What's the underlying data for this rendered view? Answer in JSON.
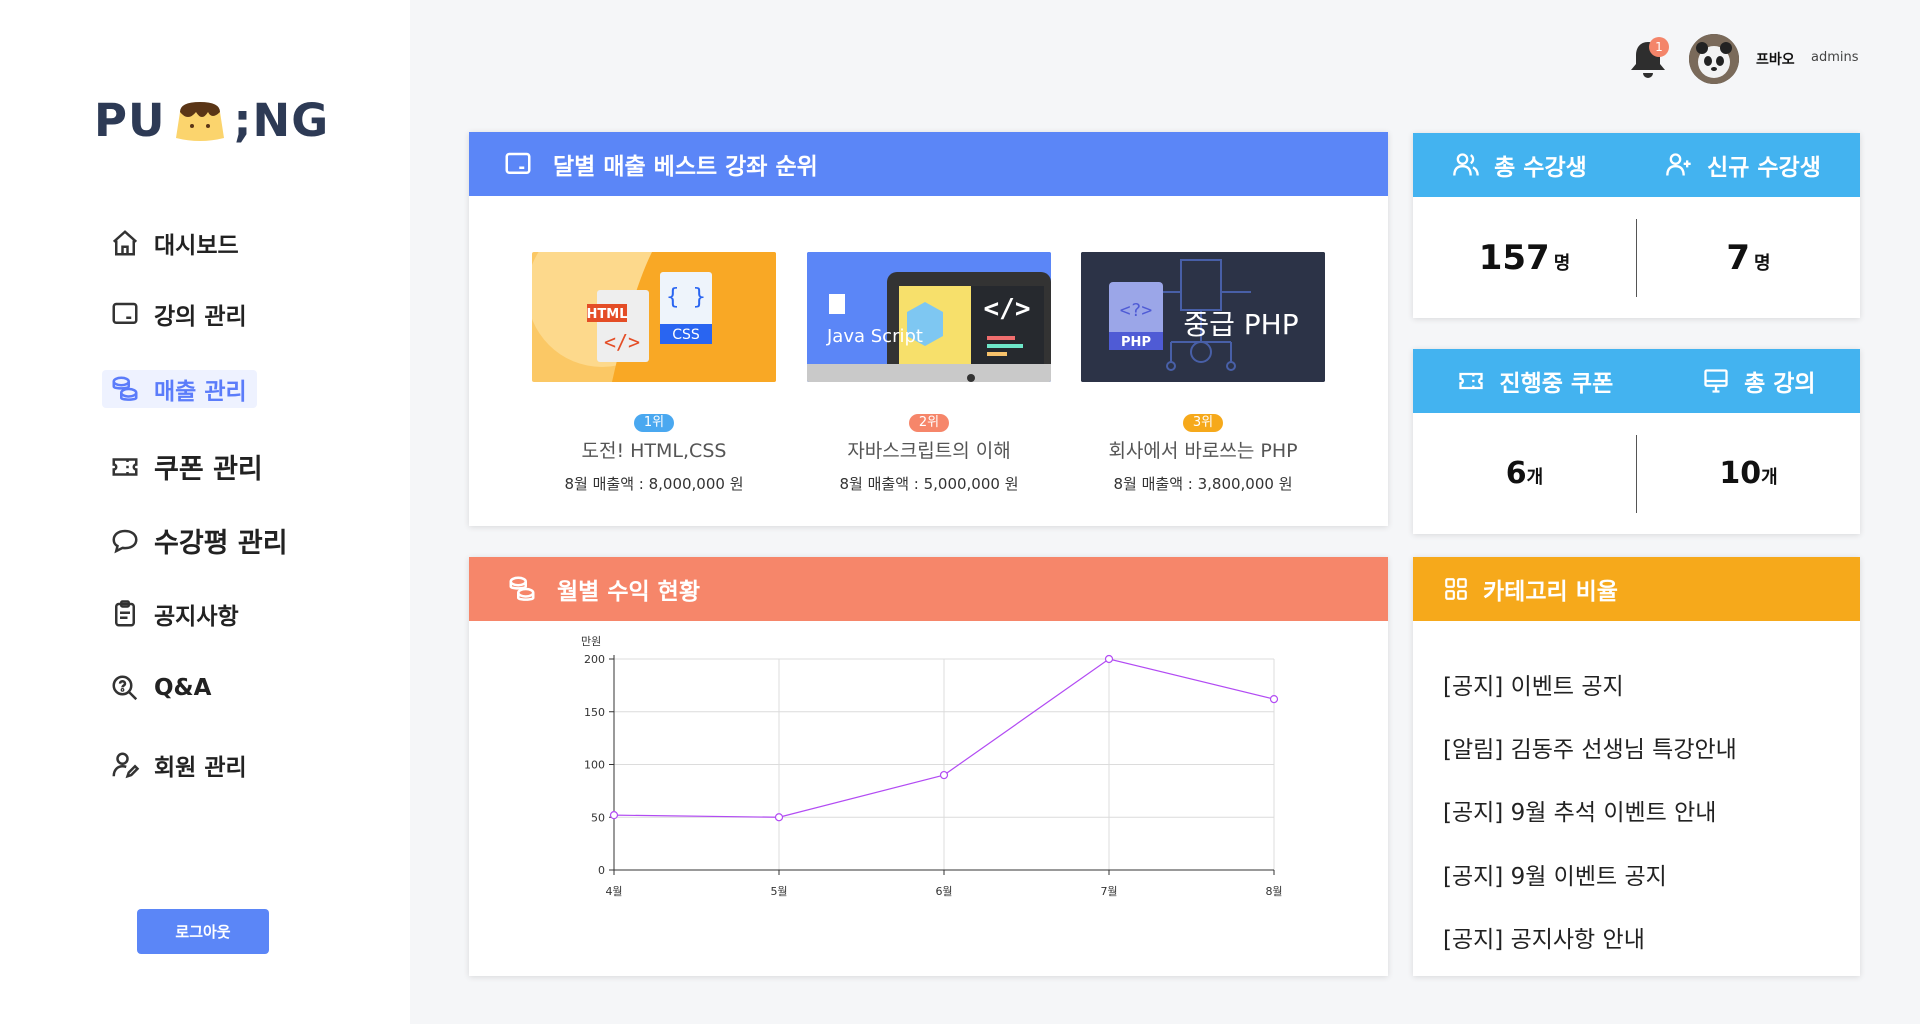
{
  "brand": {
    "logo_left": "PU",
    "logo_right": "NG"
  },
  "sidebar": {
    "items": [
      {
        "label": "대시보드",
        "icon": "home-icon"
      },
      {
        "label": "강의 관리",
        "icon": "monitor-icon"
      },
      {
        "label": "매출 관리",
        "icon": "coins-icon",
        "active": true
      },
      {
        "label": "쿠폰 관리",
        "icon": "ticket-icon"
      },
      {
        "label": "수강평 관리",
        "icon": "chat-icon"
      },
      {
        "label": "공지사항",
        "icon": "clipboard-icon"
      },
      {
        "label": "Q&A",
        "icon": "search-question-icon"
      },
      {
        "label": "회원 관리",
        "icon": "user-edit-icon"
      }
    ],
    "logout_label": "로그아웃"
  },
  "header": {
    "notification_count": "1",
    "user_name": "프바오",
    "user_role": "admins"
  },
  "best_courses": {
    "title": "달별 매출 베스트 강좌 순위",
    "items": [
      {
        "rank": "1위",
        "rank_color": "#4aa8f0",
        "title": "도전! HTML,CSS",
        "sales": "8월  매출액 : 8,000,000 원",
        "thumb_text_a": "HTML",
        "thumb_text_b": "CSS",
        "thumb_text_c": "{ }"
      },
      {
        "rank": "2위",
        "rank_color": "#f6866a",
        "title": "자바스크립트의 이해",
        "sales": "8월  매출액 : 5,000,000 원",
        "thumb_text_a": "Java Script",
        "thumb_text_b": "</>"
      },
      {
        "rank": "3위",
        "rank_color": "#f6a91b",
        "title": "회사에서 바로쓰는 PHP",
        "sales": "8월  매출액 : 3,800,000 원",
        "thumb_text_a": "중급 PHP",
        "thumb_text_b": "PHP",
        "thumb_text_c": "<?>"
      }
    ]
  },
  "stats_students": {
    "left_label": "총 수강생",
    "left_value": "157",
    "left_unit": "명",
    "right_label": "신규 수강생",
    "right_value": "7",
    "right_unit": "명"
  },
  "stats_coupons": {
    "left_label": "진행중 쿠폰",
    "left_value": "6",
    "left_unit": "개",
    "right_label": "총 강의",
    "right_value": "10",
    "right_unit": "개"
  },
  "revenue": {
    "title": "월별 수익 현황"
  },
  "chart_data": {
    "type": "line",
    "categories": [
      "4월",
      "5월",
      "6월",
      "7월",
      "8월"
    ],
    "series": [
      {
        "values": [
          52,
          50,
          90,
          200,
          162
        ]
      }
    ],
    "ylabel": "만원",
    "yticks": [
      "0",
      "50",
      "100",
      "150",
      "200"
    ],
    "ylim": [
      0,
      200
    ],
    "grid": true,
    "line_color": "#b24bf3"
  },
  "category": {
    "title": "카테고리 비율",
    "items": [
      "[공지] 이벤트 공지",
      "[알림] 김동주 선생님 특강안내",
      "[공지] 9월 추석 이벤트 안내",
      "[공지] 9월 이벤트 공지",
      "[공지] 공지사항 안내"
    ]
  }
}
